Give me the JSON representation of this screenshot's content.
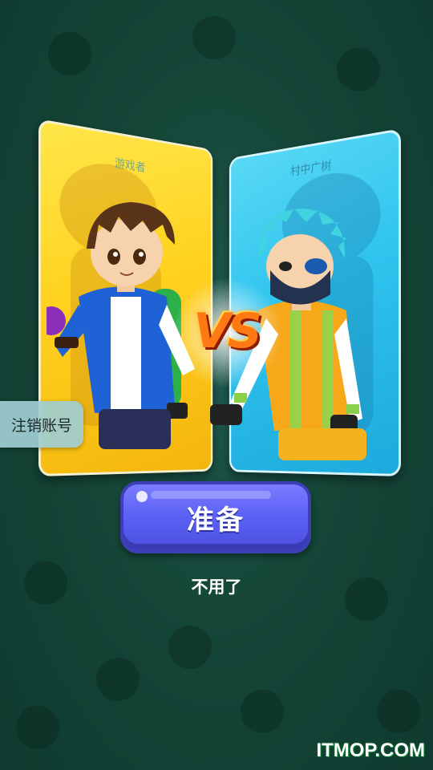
{
  "cards": {
    "left_name": "游戏者",
    "right_name": "村中广树"
  },
  "vs_label": "VS",
  "buttons": {
    "logout": "注销账号",
    "ready": "准备",
    "decline": "不用了"
  },
  "watermark": "ITMOP.COM",
  "colors": {
    "background": "#154638",
    "left_card": "#ffd21e",
    "right_card": "#2fc4ee",
    "ready_button": "#5d63f5",
    "vs_text": "#ff7a14"
  }
}
